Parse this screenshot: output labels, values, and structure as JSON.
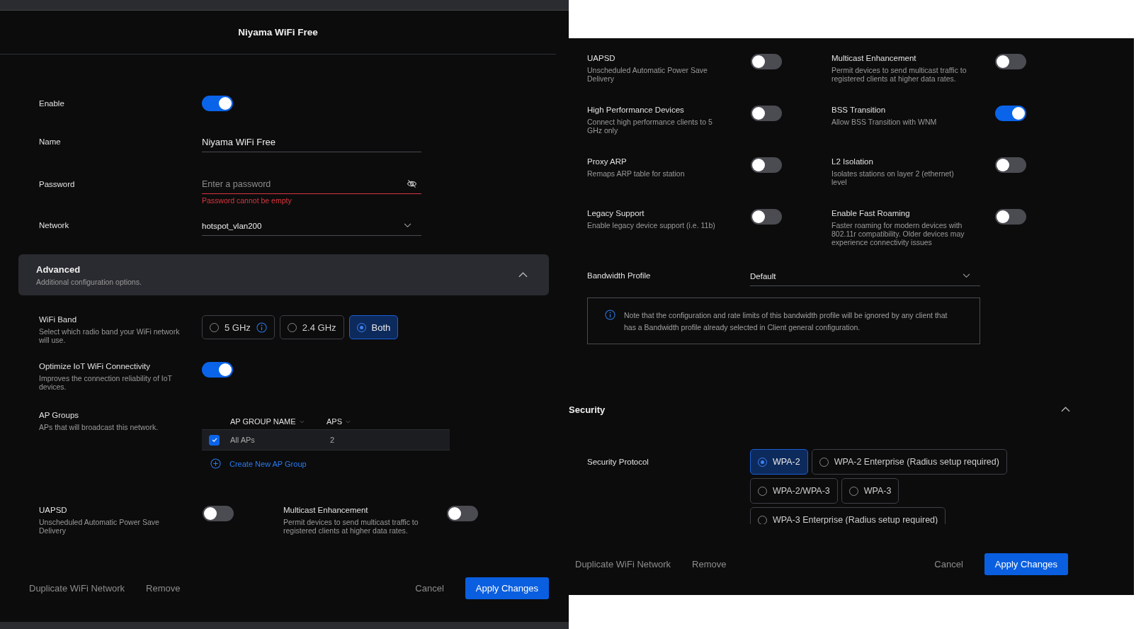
{
  "left": {
    "title": "Niyama WiFi Free",
    "enable": {
      "label": "Enable",
      "on": true
    },
    "name": {
      "label": "Name",
      "value": "Niyama WiFi Free"
    },
    "password": {
      "label": "Password",
      "placeholder": "Enter a password",
      "error": "Password cannot be empty"
    },
    "network": {
      "label": "Network",
      "value": "hotspot_vlan200"
    },
    "advanced": {
      "title": "Advanced",
      "subtitle": "Additional configuration options.",
      "expanded": true
    },
    "wifi_band": {
      "label": "WiFi Band",
      "description": "Select which radio band your WiFi network will use.",
      "options": [
        {
          "label": "5 GHz",
          "info": true,
          "selected": false
        },
        {
          "label": "2.4 GHz",
          "info": false,
          "selected": false
        },
        {
          "label": "Both",
          "info": false,
          "selected": true
        }
      ]
    },
    "iot": {
      "label": "Optimize IoT WiFi Connectivity",
      "description": "Improves the connection reliability of IoT devices.",
      "on": true
    },
    "ap_groups": {
      "label": "AP Groups",
      "description": "APs that will broadcast this network.",
      "columns": [
        "AP GROUP NAME",
        "APS"
      ],
      "rows": [
        {
          "checked": true,
          "cells": [
            "All APs",
            "2"
          ]
        }
      ],
      "create": "Create New AP Group"
    },
    "toggles": [
      {
        "label": "UAPSD",
        "description": "Unscheduled Automatic Power Save Delivery",
        "on": false
      },
      {
        "label": "Multicast Enhancement",
        "description": "Permit devices to send multicast traffic to registered clients at higher data rates.",
        "on": false
      }
    ],
    "footer": {
      "actions": [
        "Duplicate WiFi Network",
        "Remove"
      ],
      "cancel": "Cancel",
      "apply": "Apply Changes"
    }
  },
  "right": {
    "toggles": [
      {
        "label": "UAPSD",
        "description": "Unscheduled Automatic Power Save Delivery",
        "on": false
      },
      {
        "label": "Multicast Enhancement",
        "description": "Permit devices to send multicast traffic to registered clients at higher data rates.",
        "on": false
      },
      {
        "label": "High Performance Devices",
        "description": "Connect high performance clients to 5 GHz only",
        "on": false
      },
      {
        "label": "BSS Transition",
        "description": "Allow BSS Transition with WNM",
        "on": true
      },
      {
        "label": "Proxy ARP",
        "description": "Remaps ARP table for station",
        "on": false
      },
      {
        "label": "L2 Isolation",
        "description": "Isolates stations on layer 2 (ethernet) level",
        "on": false
      },
      {
        "label": "Legacy Support",
        "description": "Enable legacy device support (i.e. 11b)",
        "on": false
      },
      {
        "label": "Enable Fast Roaming",
        "description": "Faster roaming for modern devices with 802.11r compatibility. Older devices may experience connectivity issues",
        "on": false
      }
    ],
    "bandwidth": {
      "label": "Bandwidth Profile",
      "value": "Default"
    },
    "note": "Note that the configuration and rate limits of this bandwidth profile will be ignored by any client that has a Bandwidth profile already selected in Client general configuration.",
    "security": {
      "title": "Security",
      "expanded": true,
      "label": "Security Protocol",
      "options": [
        {
          "label": "WPA-2",
          "selected": true
        },
        {
          "label": "WPA-2 Enterprise (Radius setup required)",
          "selected": false
        },
        {
          "label": "WPA-2/WPA-3",
          "selected": false
        },
        {
          "label": "WPA-3",
          "selected": false
        },
        {
          "label": "WPA-3 Enterprise (Radius setup required)",
          "selected": false
        }
      ]
    },
    "footer": {
      "actions": [
        "Duplicate WiFi Network",
        "Remove"
      ],
      "cancel": "Cancel",
      "apply": "Apply Changes"
    }
  }
}
